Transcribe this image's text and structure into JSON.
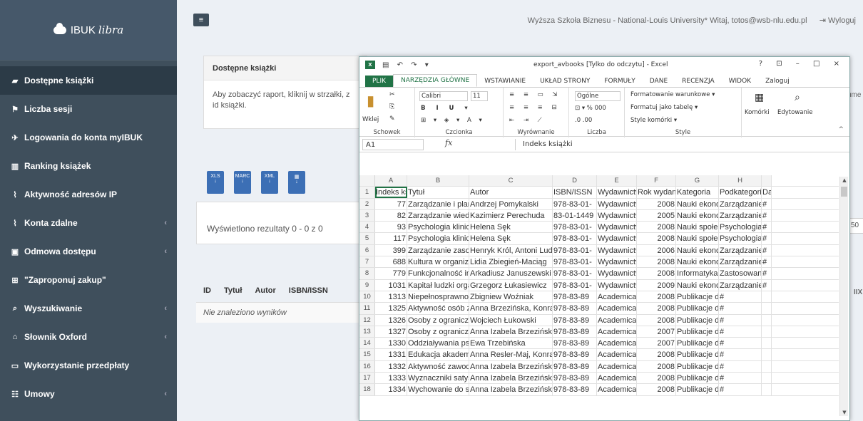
{
  "brand": {
    "name": "IBUK",
    "suffix": "libra"
  },
  "sidebar": {
    "items": [
      {
        "label": "Dostępne książki",
        "icon": "book-icon",
        "glyph": "▰",
        "chevron": false
      },
      {
        "label": "Liczba sesji",
        "icon": "flag-icon",
        "glyph": "⚑",
        "chevron": false
      },
      {
        "label": "Logowania do konta myIBUK",
        "icon": "rocket-icon",
        "glyph": "✈",
        "chevron": false
      },
      {
        "label": "Ranking książek",
        "icon": "bar-chart-icon",
        "glyph": "▥",
        "chevron": false
      },
      {
        "label": "Aktywność adresów IP",
        "icon": "line-chart-icon",
        "glyph": "⌇",
        "chevron": false
      },
      {
        "label": "Konta zdalne",
        "icon": "area-chart-icon",
        "glyph": "⌇",
        "chevron": true
      },
      {
        "label": "Odmowa dostępu",
        "icon": "lock-icon",
        "glyph": "▣",
        "chevron": true
      },
      {
        "label": "\"Zaproponuj zakup\"",
        "icon": "plus-square-icon",
        "glyph": "⊞",
        "chevron": false
      },
      {
        "label": "Wyszukiwanie",
        "icon": "search-icon",
        "glyph": "⌕",
        "chevron": true
      },
      {
        "label": "Słownik Oxford",
        "icon": "graduation-cap-icon",
        "glyph": "⌂",
        "chevron": true
      },
      {
        "label": "Wykorzystanie przedpłaty",
        "icon": "money-icon",
        "glyph": "▭",
        "chevron": false
      },
      {
        "label": "Umowy",
        "icon": "users-icon",
        "glyph": "☷",
        "chevron": true
      }
    ],
    "chevron": "‹"
  },
  "header": {
    "menu_icon": "≡",
    "institution": "Wyższa Szkoła Biznesu - National-Louis University*",
    "greeting": "Witaj, totos@wsb-nlu.edu.pl",
    "logout": "Wyloguj"
  },
  "panel": {
    "title": "Dostępne książki",
    "body": "Aby zobaczyć raport, kliknij w strzałki, z id książki."
  },
  "exports": [
    "XLS",
    "MARC",
    "XML",
    "▦"
  ],
  "results": {
    "text": "Wyświetlono rezultaty 0 - 0 z 0"
  },
  "table": {
    "headers": [
      "ID",
      "Tytuł",
      "Autor",
      "ISBN/ISSN"
    ],
    "empty": "Nie znaleziono wyników"
  },
  "right_fragments": {
    "top": "ume",
    "box": "50",
    "ix": "IIX"
  },
  "excel": {
    "title": "export_avbooks  [Tylko do odczytu] - Excel",
    "window_controls": "? ⊡ – □ ×",
    "tabs": [
      "PLIK",
      "NARZĘDZIA GŁÓWNE",
      "WSTAWIANIE",
      "UKŁAD STRONY",
      "FORMUŁY",
      "DANE",
      "RECENZJA",
      "WIDOK",
      "Zaloguj"
    ],
    "ribbon": {
      "paste": "Wklej",
      "font_name": "Calibri",
      "font_size": "11",
      "number_format": "Ogólne",
      "cond_format": "Formatowanie warunkowe ▾",
      "format_table": "Formatuj jako tabelę ▾",
      "cell_styles": "Style komórki ▾",
      "cells": "Komórki",
      "editing": "Edytowanie",
      "groups": [
        "Schowek",
        "Czcionka",
        "Wyrównanie",
        "Liczba",
        "Style"
      ]
    },
    "name_box": "A1",
    "formula_value": "Indeks książki",
    "columns": [
      "A",
      "B",
      "C",
      "D",
      "E",
      "F",
      "G",
      "H"
    ],
    "rows": [
      [
        "1",
        "Indeks książki",
        "Tytuł",
        "Autor",
        "ISBN/ISSN",
        "Wydawnictwo",
        "Rok wydania",
        "Kategoria",
        "Podkategoria",
        "Da"
      ],
      [
        "2",
        "77",
        "Zarządzanie i planowanie",
        "Andrzej Pomykalski",
        "978-83-01-",
        "Wydawnictwo",
        "2008",
        "Nauki ekonomiczne",
        "Zarządzanie",
        "#"
      ],
      [
        "3",
        "82",
        "Zarządzanie wiedzą w przedsiębiorstwie",
        "Kazimierz Perechuda",
        "83-01-1449",
        "Wydawnictwo",
        "2005",
        "Nauki ekonomiczne",
        "Zarządzanie",
        "#"
      ],
      [
        "4",
        "93",
        "Psychologia kliniczna, t.",
        "Helena Sęk",
        "978-83-01-",
        "Wydawnictwo",
        "2008",
        "Nauki społeczne",
        "Psychologia",
        "#"
      ],
      [
        "5",
        "117",
        "Psychologia kliniczna, t.",
        "Helena Sęk",
        "978-83-01-",
        "Wydawnictwo",
        "2008",
        "Nauki społeczne",
        "Psychologia",
        "#"
      ],
      [
        "6",
        "399",
        "Zarządzanie zasobami ludzkimi",
        "Henryk Król, Antoni Ludwiczyński",
        "978-83-01-",
        "Wydawnictwo",
        "2006",
        "Nauki ekonomiczne",
        "Zarządzanie",
        "#"
      ],
      [
        "7",
        "688",
        "Kultura w organizacji",
        "Lidia Zbiegień-Maciąg",
        "978-83-01-",
        "Wydawnictwo",
        "2008",
        "Nauki ekonomiczne",
        "Zarządzanie",
        "#"
      ],
      [
        "8",
        "779",
        "Funkcjonalność informatyki",
        "Arkadiusz Januszewski",
        "978-83-01-",
        "Wydawnictwo",
        "2008",
        "Informatyka",
        "Zastosowania",
        "#"
      ],
      [
        "9",
        "1031",
        "Kapitał ludzki organizacji",
        "Grzegorz Łukasiewicz",
        "978-83-01-",
        "Wydawnictwo",
        "2009",
        "Nauki ekonomiczne",
        "Zarządzanie",
        "#"
      ],
      [
        "10",
        "1313",
        "Niepełnosprawność i niezależność",
        "Zbigniew Woźniak",
        "978-83-89",
        "Academica",
        "2008",
        "Publikacje darmowe",
        "#",
        ""
      ],
      [
        "11",
        "1325",
        "Aktywność osób z ograniczeniami",
        "Anna Brzezińska, Konrad Piotrowski",
        "978-83-89",
        "Academica",
        "2008",
        "Publikacje darmowe",
        "#",
        ""
      ],
      [
        "12",
        "1326",
        "Osoby z ograniczoną sprawnością",
        "Wojciech Łukowski",
        "978-83-89",
        "Academica",
        "2008",
        "Publikacje darmowe",
        "#",
        ""
      ],
      [
        "13",
        "1327",
        "Osoby z ograniczoną sprawnością",
        "Anna Izabela Brzezińska, Zbigniew",
        "978-83-89",
        "Academica",
        "2007",
        "Publikacje darmowe",
        "#",
        ""
      ],
      [
        "14",
        "1330",
        "Oddziaływania psychologiczne",
        "Ewa Trzebińska",
        "978-83-89",
        "Academica",
        "2007",
        "Publikacje darmowe",
        "#",
        ""
      ],
      [
        "15",
        "1331",
        "Edukacja akademicka szansą",
        "Anna Resler-Maj, Konrad Maj",
        "978-83-89",
        "Academica",
        "2008",
        "Publikacje darmowe",
        "#",
        ""
      ],
      [
        "16",
        "1332",
        "Aktywność zawodowa osób",
        "Anna Izabela Brzezińska, Konrad",
        "978-83-89",
        "Academica",
        "2008",
        "Publikacje darmowe",
        "#",
        ""
      ],
      [
        "17",
        "1333",
        "Wyznaczniki satysfakcji z życia",
        "Anna Izabela Brzezińska, Konrad",
        "978-83-89",
        "Academica",
        "2008",
        "Publikacje darmowe",
        "#",
        ""
      ],
      [
        "18",
        "1334",
        "Wychowanie do samodzielności",
        "Anna Izabela Brzezińska, Radosław",
        "978-83-89",
        "Academica",
        "2008",
        "Publikacje darmowe",
        "#",
        ""
      ]
    ]
  }
}
